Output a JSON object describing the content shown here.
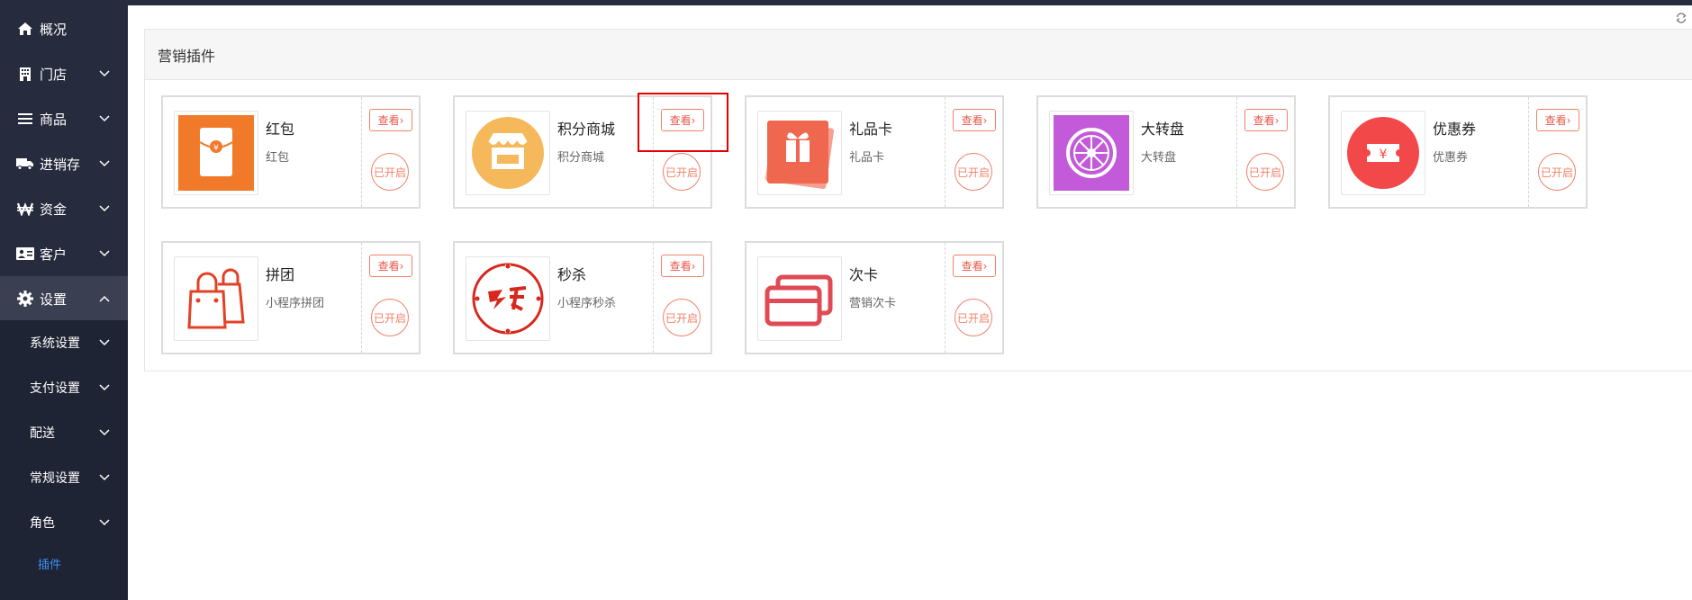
{
  "sidebar": {
    "items": [
      {
        "label": "概况",
        "icon": "home-icon"
      },
      {
        "label": "门店",
        "icon": "building-icon"
      },
      {
        "label": "商品",
        "icon": "list-icon"
      },
      {
        "label": "进销存",
        "icon": "truck-icon"
      },
      {
        "label": "资金",
        "icon": "won-icon"
      },
      {
        "label": "客户",
        "icon": "id-card-icon"
      },
      {
        "label": "设置",
        "icon": "gear-icon"
      }
    ],
    "sub_items": [
      {
        "label": "系统设置"
      },
      {
        "label": "支付设置"
      },
      {
        "label": "配送"
      },
      {
        "label": "常规设置"
      },
      {
        "label": "角色"
      },
      {
        "label": "插件"
      }
    ]
  },
  "panel": {
    "title": "营销插件"
  },
  "view_label": "查看",
  "status_label": "已开启",
  "colors": {
    "accent": "#e8574a",
    "sidebar": "#262b3d",
    "active_sub": "#3a8ef6",
    "highlight": "#e60000"
  },
  "plugins": [
    {
      "title": "红包",
      "desc": "红包",
      "icon": "red-envelope-icon"
    },
    {
      "title": "积分商城",
      "desc": "积分商城",
      "icon": "store-icon"
    },
    {
      "title": "礼品卡",
      "desc": "礼品卡",
      "icon": "gift-card-icon"
    },
    {
      "title": "大转盘",
      "desc": "大转盘",
      "icon": "wheel-icon"
    },
    {
      "title": "优惠券",
      "desc": "优惠券",
      "icon": "coupon-icon"
    },
    {
      "title": "拼团",
      "desc": "小程序拼团",
      "icon": "shopping-bags-icon"
    },
    {
      "title": "秒杀",
      "desc": "小程序秒杀",
      "icon": "flash-sale-icon"
    },
    {
      "title": "次卡",
      "desc": "营销次卡",
      "icon": "cards-icon"
    }
  ]
}
